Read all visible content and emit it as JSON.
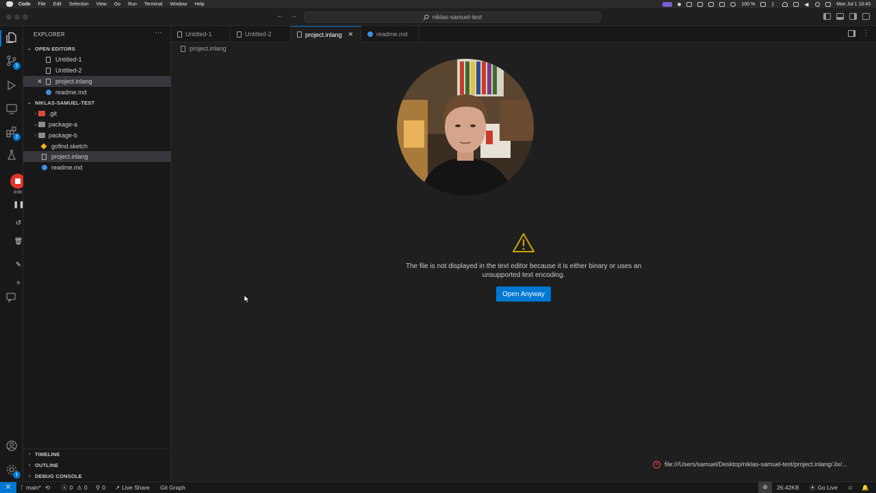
{
  "menubar": {
    "app": "Code",
    "items": [
      "File",
      "Edit",
      "Selection",
      "View",
      "Go",
      "Run",
      "Terminal",
      "Window",
      "Help"
    ],
    "battery": "100 %",
    "clock": "Mon Jul 1  10:43"
  },
  "titlebar": {
    "search_text": "niklas-samuel-test",
    "search_icon": "search-icon"
  },
  "activitybar": {
    "scm_badge": "2",
    "extensions_badge": "2",
    "accounts_badge": "1",
    "recording_time": "0:00"
  },
  "sidebar": {
    "title": "EXPLORER",
    "more": "···",
    "open_editors": {
      "header": "OPEN EDITORS",
      "items": [
        "Untitled-1",
        "Untitled-2",
        "project.inlang",
        "readme.md"
      ]
    },
    "workspace": {
      "header": "NIKLAS-SAMUEL-TEST",
      "items": [
        ".git",
        "package-a",
        "package-b",
        "gofind.sketch",
        "project.inlang",
        "readme.md"
      ]
    },
    "timeline": "TIMELINE",
    "outline": "OUTLINE",
    "debug_console": "DEBUG CONSOLE"
  },
  "tabs": [
    {
      "label": "Untitled-1"
    },
    {
      "label": "Untitled-2"
    },
    {
      "label": "project.inlang"
    },
    {
      "label": "readme.md"
    }
  ],
  "editor": {
    "breadcrumb": "project.inlang",
    "message": "The file is not displayed in the text editor because it is either binary or uses an unsupported text encoding.",
    "open_button": "Open Anyway"
  },
  "notification": {
    "text": "file:///Users/samuel/Desktop/niklas-samuel-test/project.inlang/.lix/..."
  },
  "statusbar": {
    "branch": "main*",
    "errors": "0",
    "warnings": "0",
    "ports": "0",
    "live_share": "Live Share",
    "git_graph": "Git Graph",
    "file_size": "26.42KB",
    "go_live": "Go Live"
  },
  "colors": {
    "accent": "#0078d4",
    "record": "#e0352b",
    "warning": "#cca700",
    "error": "#f14c4c"
  }
}
